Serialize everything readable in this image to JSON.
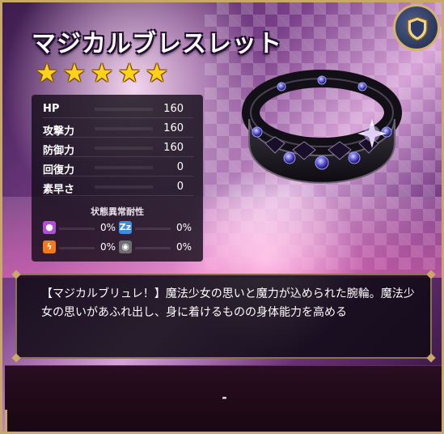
{
  "item": {
    "name": "マジカルブレスレット",
    "rarity_stars": 5,
    "star_glyph": "★"
  },
  "stats": [
    {
      "label": "HP",
      "value": "160"
    },
    {
      "label": "攻撃力",
      "value": "160"
    },
    {
      "label": "防御力",
      "value": "160"
    },
    {
      "label": "回復力",
      "value": "0"
    },
    {
      "label": "素早さ",
      "value": "0"
    }
  ],
  "resistances": {
    "title": "状態異常耐性",
    "items": [
      {
        "icon": "poison-icon",
        "glyph": "●",
        "color": "#b04fd6",
        "value": "0%"
      },
      {
        "icon": "sleep-icon",
        "glyph": "Zz",
        "color": "#3a8de0",
        "value": "0%"
      },
      {
        "icon": "paralysis-icon",
        "glyph": "ϟ",
        "color": "#f07a1c",
        "value": "0%"
      },
      {
        "icon": "stone-icon",
        "glyph": "◉",
        "color": "#6e6e6e",
        "value": "0%"
      }
    ]
  },
  "description": "【マジカルブリュレ！】魔法少女の思いと魔力が込められた腕輪。魔法少女の思いがあふれ出し、身に着けるものの身体能力を高める",
  "footer": {
    "text": "-"
  },
  "colors": {
    "gold_frame": "#c9a86a",
    "star": "#ffd21a",
    "panel": "#140e18"
  }
}
